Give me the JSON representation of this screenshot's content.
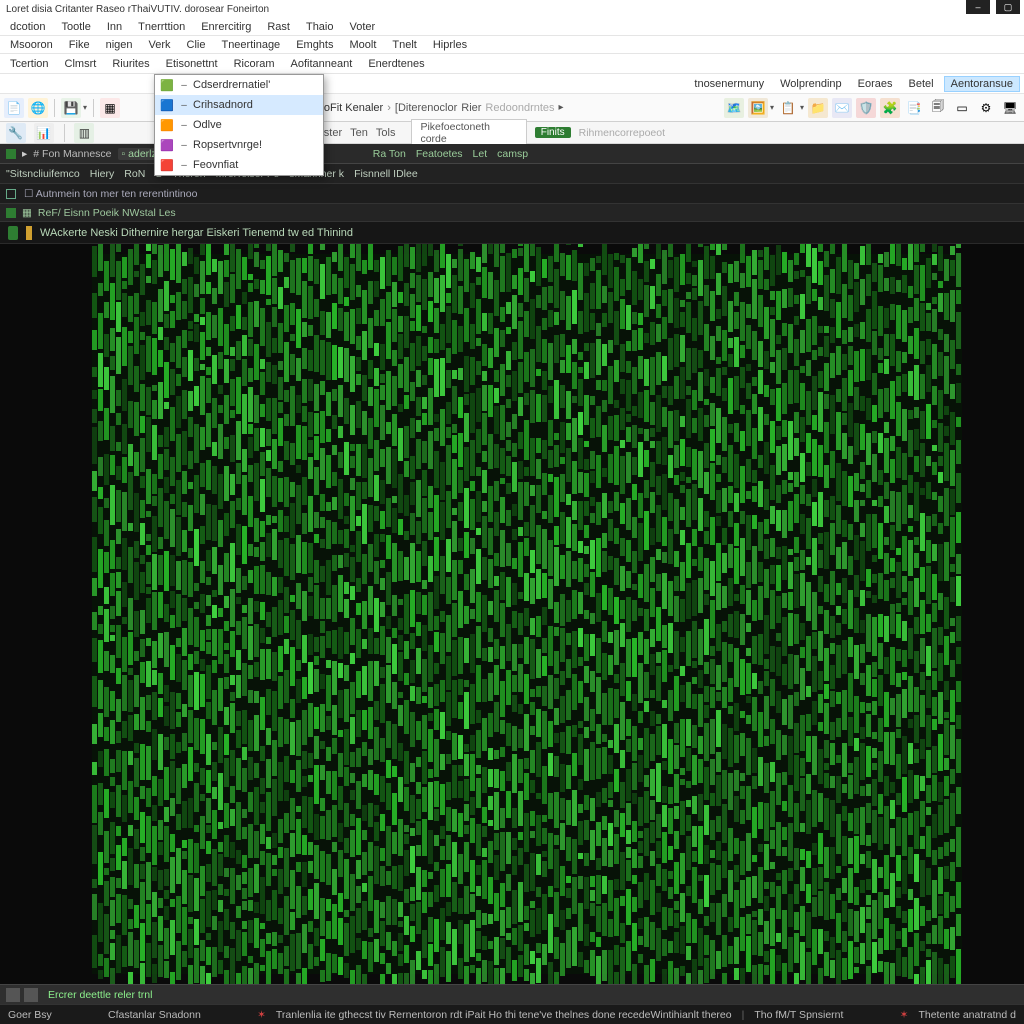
{
  "title": "Loret disia Critanter Raseo rThaiVUTIV. dorosear Foneirton",
  "menurow1": [
    "dcotion",
    "Tootle",
    "Inn",
    "Tnerrttion",
    "Enrercitirg",
    "Rast",
    "Thaio",
    "Voter"
  ],
  "menurow2": [
    "Msooron",
    "Fike",
    "nigen",
    "Verk",
    "Clie",
    "Tneertinage",
    "Emghts",
    "Moolt",
    "Tnelt",
    "Hiprles"
  ],
  "menurow3": [
    "Tcertion",
    "Clmsrt",
    "Riurites",
    "Etisonettnt",
    "Ricoram",
    "Aofitanneant",
    "Enerdtenes"
  ],
  "menurow4": [
    "tnosenermuny",
    "Wolprendinp",
    "Eoraes",
    "Betel",
    "Aentoransue"
  ],
  "menurow4_active_index": 4,
  "secondary_tabs": {
    "field": "Pikefoectoneth corde",
    "badge": "Finits",
    "ghost": "Rihmencorrepoeot"
  },
  "toolbar_center": {
    "label": "RisoFit Kenaler",
    "sep": "›",
    "sub": "[Diterenoclor",
    "sub2": "Rier",
    "sub3": "Redoondrntes",
    "chev": "▸"
  },
  "toolbar2": {
    "a": "tectulster",
    "b": "Ten",
    "c": "Tols"
  },
  "dropdown": [
    {
      "icon": "🟩",
      "label": "Cdserdrernatiel'"
    },
    {
      "icon": "🟦",
      "label": "Crihsadnord",
      "active": true
    },
    {
      "icon": "🟧",
      "label": "Odlve"
    },
    {
      "icon": "🟪",
      "label": "Ropsertvnrge!"
    },
    {
      "icon": "🟥",
      "label": "Feovnfiat"
    }
  ],
  "breadcrumb": {
    "caret": "▸",
    "path": "# Fon Mannesce",
    "chip": "▫ aderlz"
  },
  "breadcrumb_tail": [
    "Ra Ton",
    "Featoetes",
    "Let",
    "camsp"
  ],
  "infobar": [
    "\"Sitsncliuifemco",
    "Hiery",
    "RoN",
    "S",
    "Tneren",
    "MreiTeiser Fe",
    "sMannner k",
    "Fisnnell IDlee"
  ],
  "infobar2_prefix": "☐ Autnmein ton mer ten rerentintinoo",
  "linkbar": {
    "ico": "▦",
    "text": "ReF/ Eisnn Poeik NWstal Les"
  },
  "status_msg": "WAckerte Neski Dithernire hergar Eiskeri Tienemd tw ed Thinind",
  "footer_input_label": "Ercrer deettle reler trnl",
  "bottombar": {
    "left": "Goer Bsy",
    "mid1": "Cfastanlar Snadonn",
    "mid2": "Tranlenlia ite gthecst tiv Rernentoron rdt iPait Ho thi tene've thelnes done recedeWintihianlt thereo",
    "mid3": "Tho fM/T Spnsiernt",
    "right": "Thetente anatratnd d"
  },
  "colors": {
    "green1": "#1e7a1e",
    "green2": "#2aa02a",
    "green3": "#3ecf3e",
    "dark": "#0a0a0a"
  }
}
